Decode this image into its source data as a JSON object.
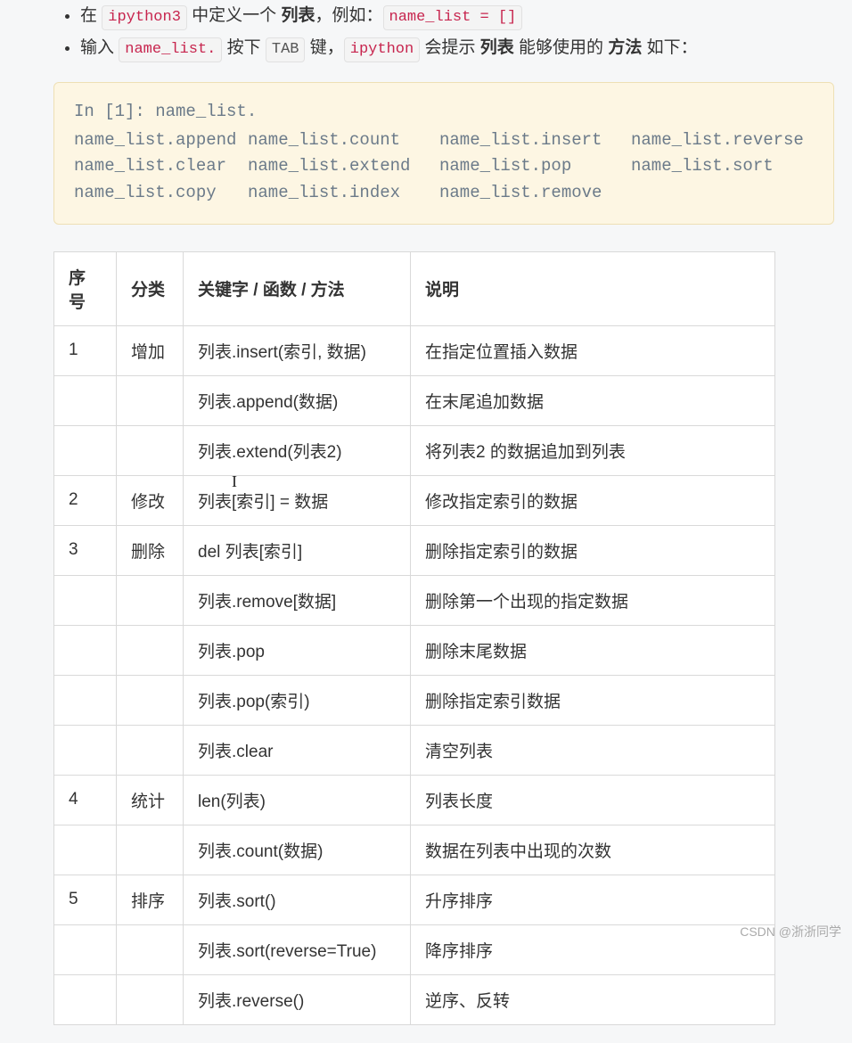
{
  "bullets": {
    "b1_pre": "在 ",
    "b1_code1": "ipython3",
    "b1_mid1": " 中定义一个 ",
    "b1_bold1": "列表",
    "b1_mid2": "，例如：",
    "b1_code2": "name_list = []",
    "b2_pre": "输入 ",
    "b2_code1": "name_list.",
    "b2_mid1": " 按下 ",
    "b2_code2": "TAB",
    "b2_mid2": " 键，",
    "b2_code3": "ipython",
    "b2_mid3": " 会提示 ",
    "b2_bold1": "列表",
    "b2_mid4": " 能够使用的 ",
    "b2_bold2": "方法",
    "b2_mid5": " 如下："
  },
  "callout": {
    "line1": "In [1]: name_list.",
    "c1r1": "name_list.append",
    "c2r1": "name_list.count",
    "c3r1": "name_list.insert",
    "c4r1": "name_list.reverse",
    "c1r2": "name_list.clear",
    "c2r2": "name_list.extend",
    "c3r2": "name_list.pop",
    "c4r2": "name_list.sort",
    "c1r3": "name_list.copy",
    "c2r3": "name_list.index",
    "c3r3": "name_list.remove",
    "c4r3": ""
  },
  "table": {
    "headers": {
      "h1": "序号",
      "h2": "分类",
      "h3": "关键字 / 函数 / 方法",
      "h4": "说明"
    },
    "rows": [
      {
        "n": "1",
        "cat": "增加",
        "key": "列表.insert(索引, 数据)",
        "desc": "在指定位置插入数据"
      },
      {
        "n": "",
        "cat": "",
        "key": "列表.append(数据)",
        "desc": "在末尾追加数据"
      },
      {
        "n": "",
        "cat": "",
        "key": "列表.extend(列表2)",
        "desc": "将列表2 的数据追加到列表"
      },
      {
        "n": "2",
        "cat": "修改",
        "key": "列表[索引] = 数据",
        "desc": "修改指定索引的数据"
      },
      {
        "n": "3",
        "cat": "删除",
        "key": "del 列表[索引]",
        "desc": "删除指定索引的数据"
      },
      {
        "n": "",
        "cat": "",
        "key": "列表.remove[数据]",
        "desc": "删除第一个出现的指定数据"
      },
      {
        "n": "",
        "cat": "",
        "key": "列表.pop",
        "desc": "删除末尾数据"
      },
      {
        "n": "",
        "cat": "",
        "key": "列表.pop(索引)",
        "desc": "删除指定索引数据"
      },
      {
        "n": "",
        "cat": "",
        "key": "列表.clear",
        "desc": "清空列表"
      },
      {
        "n": "4",
        "cat": "统计",
        "key": "len(列表)",
        "desc": "列表长度"
      },
      {
        "n": "",
        "cat": "",
        "key": "列表.count(数据)",
        "desc": "数据在列表中出现的次数"
      },
      {
        "n": "5",
        "cat": "排序",
        "key": "列表.sort()",
        "desc": "升序排序"
      },
      {
        "n": "",
        "cat": "",
        "key": "列表.sort(reverse=True)",
        "desc": "降序排序"
      },
      {
        "n": "",
        "cat": "",
        "key": "列表.reverse()",
        "desc": "逆序、反转"
      }
    ]
  },
  "watermark": "CSDN @浙浙同学"
}
